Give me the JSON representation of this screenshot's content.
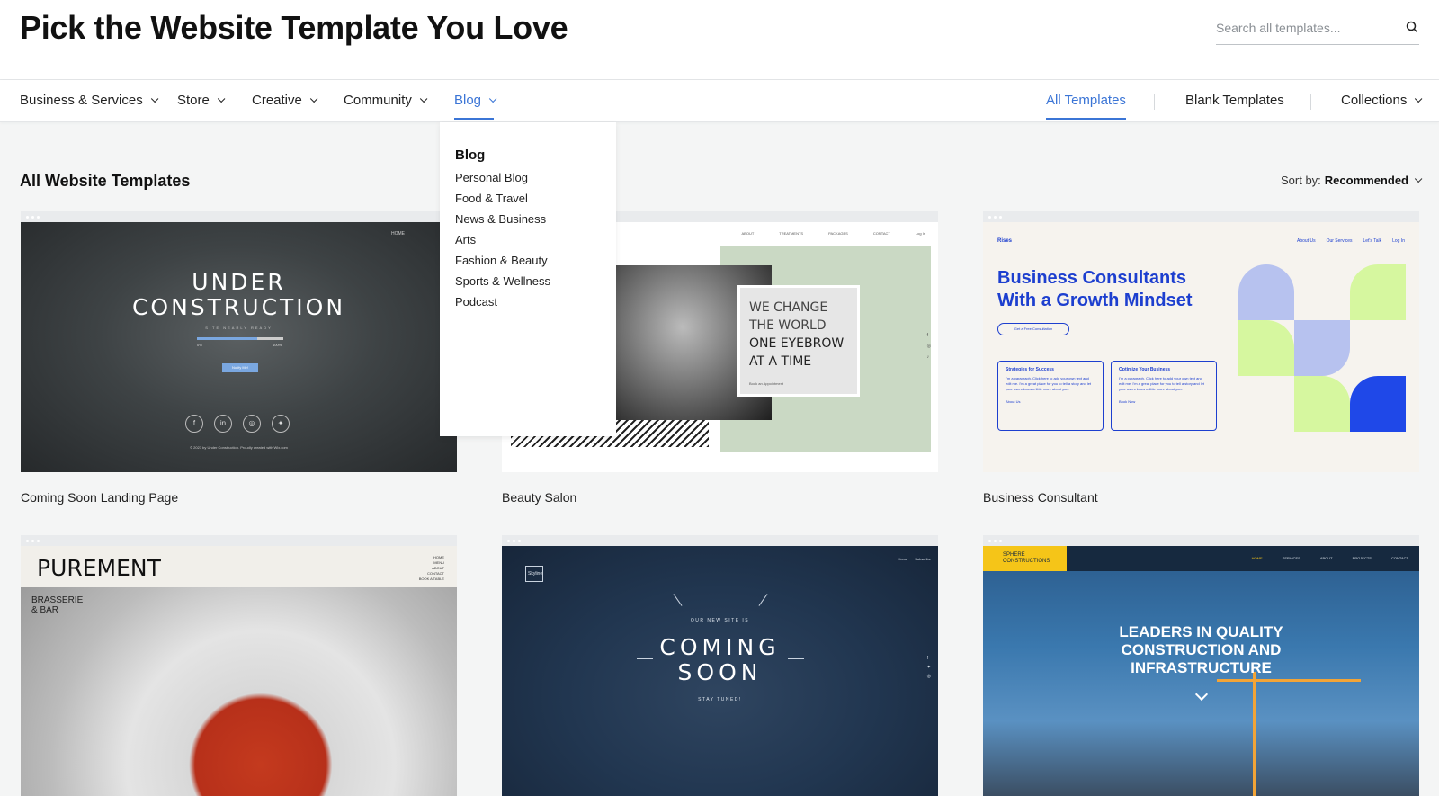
{
  "header": {
    "title": "Pick the Website Template You Love",
    "search_placeholder": "Search all templates..."
  },
  "nav": {
    "left": [
      {
        "label": "Business & Services"
      },
      {
        "label": "Store"
      },
      {
        "label": "Creative"
      },
      {
        "label": "Community"
      },
      {
        "label": "Blog",
        "active": true
      }
    ],
    "right": {
      "all": "All Templates",
      "blank": "Blank Templates",
      "collections": "Collections"
    },
    "colors": {
      "accent": "#3b75d6"
    }
  },
  "dropdown": {
    "heading": "Blog",
    "items": [
      "Personal Blog",
      "Food & Travel",
      "News & Business",
      "Arts",
      "Fashion & Beauty",
      "Sports & Wellness",
      "Podcast"
    ]
  },
  "section": {
    "title": "All Website Templates",
    "sort_label": "Sort by:",
    "sort_value": "Recommended"
  },
  "cards": [
    {
      "label": "Coming Soon Landing Page",
      "preview": {
        "nav": "HOME",
        "line1": "UNDER",
        "line2": "CONSTRUCTION",
        "sub": "SITE NEARLY READY",
        "progress_start": "0%",
        "progress_end": "100%",
        "button": "Notify Me!",
        "footer": "© 2023 by Under Construction. Proudly created with Wix.com"
      }
    },
    {
      "label": "Beauty Salon",
      "preview": {
        "nav": [
          "ABOUT",
          "TREATMENTS",
          "PACKAGES",
          "CONTACT",
          "Log In"
        ],
        "l1": "WE CHANGE",
        "l2": "THE WORLD",
        "l3": "ONE EYEBROW",
        "l4": "AT A TIME",
        "link": "Book an Appointment"
      }
    },
    {
      "label": "Business Consultant",
      "preview": {
        "logo": "Rises",
        "nav": [
          "About Us",
          "Our Services",
          "Let's Talk",
          "Log In"
        ],
        "h1": "Business Consultants",
        "h2": "With a Growth Mindset",
        "cta": "Get a Free Consultation",
        "c1_title": "Strategies for Success",
        "c1_text": "I'm a paragraph. Click here to add your own text and edit me. I'm a great place for you to tell a story and let your users know a little more about you.",
        "c1_link": "About Us",
        "c2_title": "Optimize Your Business",
        "c2_text": "I'm a paragraph. Click here to add your own text and edit me. I'm a great place for you to tell a story and let your users know a little more about you.",
        "c2_link": "Book Now"
      }
    },
    {
      "label": "",
      "preview": {
        "logo": "PUREMENT",
        "menu": [
          "HOME",
          "MENU",
          "ABOUT",
          "CONTACT",
          "BOOK A TABLE"
        ],
        "sub1": "BRASSERIE",
        "sub2": "& BAR"
      }
    },
    {
      "label": "",
      "preview": {
        "logo": "Skyline",
        "nav": [
          "Home",
          "Subscribe"
        ],
        "pre": "OUR NEW SITE IS",
        "l1": "COMING",
        "l2": "SOON",
        "post": "STAY TUNED!"
      }
    },
    {
      "label": "",
      "preview": {
        "logo1": "SPHERE",
        "logo2": "CONSTRUCTIONS",
        "nav": [
          "HOME",
          "SERVICES",
          "ABOUT",
          "PROJECTS",
          "CONTACT"
        ],
        "l1": "LEADERS IN QUALITY",
        "l2": "CONSTRUCTION AND",
        "l3": "INFRASTRUCTURE"
      }
    }
  ]
}
